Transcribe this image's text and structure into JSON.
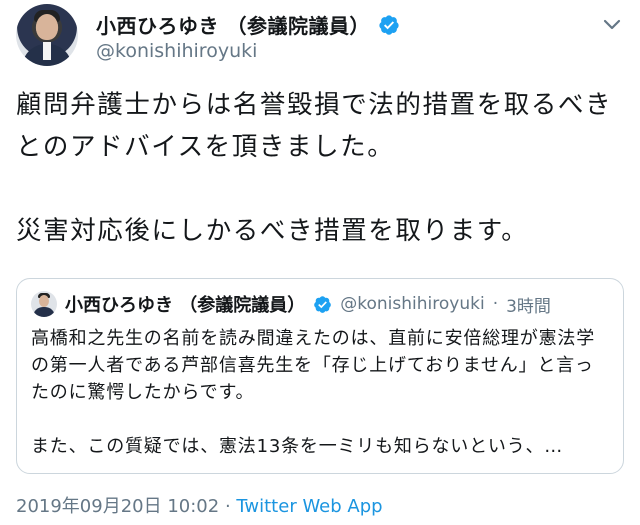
{
  "author": {
    "display_name": "小西ひろゆき （参議院議員）",
    "handle": "@konishihiroyuki",
    "verified": true
  },
  "tweet": {
    "text": "顧問弁護士からは名誉毀損で法的措置を取るべきとのアドバイスを頂きました。\n\n災害対応後にしかるべき措置を取ります。"
  },
  "quoted_tweet": {
    "display_name": "小西ひろゆき （参議院議員）",
    "handle": "@konishihiroyuki",
    "separator": "·",
    "time": "3時間",
    "paragraph1": "高橋和之先生の名前を読み間違えたのは、直前に安倍総理が憲法学の第一人者である芦部信喜先生を「存じ上げておりません」と言ったのに驚愕したからです。",
    "paragraph2": "また、この質疑では、憲法13条を一ミリも知らないという、…"
  },
  "meta": {
    "timestamp": "2019年09月20日 10:02",
    "separator": " · ",
    "source": "Twitter Web App"
  },
  "colors": {
    "text": "#14171a",
    "secondary": "#657786",
    "link": "#1b95e0",
    "verified": "#1da1f2",
    "border": "#ccd6dd"
  },
  "icons": {
    "verified": "verified-badge-icon",
    "menu": "chevron-down-icon"
  }
}
